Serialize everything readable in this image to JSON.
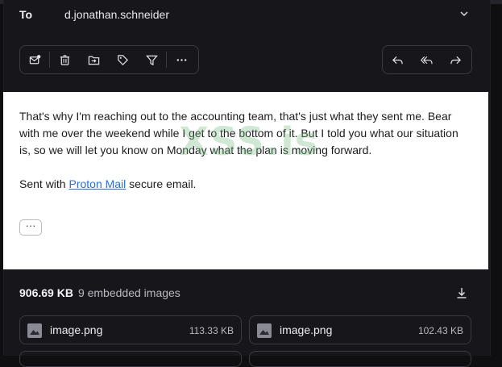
{
  "header": {
    "to_label": "To",
    "to_value": "d.jonathan.schneider"
  },
  "toolbar": {
    "left": [
      "mark-unread",
      "trash",
      "move-to-folder",
      "label",
      "filter",
      "more"
    ],
    "right": [
      "reply",
      "reply-all",
      "forward"
    ]
  },
  "message": {
    "body": "That's why I'm reaching out to the accounting team, that's just what they sent me. Bear with me over the weekend while I get to the bottom of it. But I told you what our situation is, so we will let you know on Monday what the plan is moving forward.",
    "signature_prefix": "Sent with ",
    "signature_link": "Proton Mail",
    "signature_suffix": " secure email.",
    "more_label": "···"
  },
  "watermark": "XSS.is",
  "attachments": {
    "total_size": "906.69 KB",
    "count_label": "9 embedded images",
    "items": [
      {
        "name": "image.png",
        "size": "113.33 KB"
      },
      {
        "name": "image.png",
        "size": "102.43 KB"
      }
    ]
  }
}
